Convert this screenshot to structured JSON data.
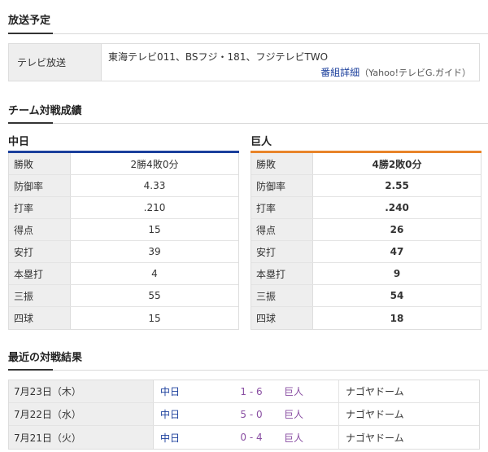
{
  "broadcast": {
    "title": "放送予定",
    "label": "テレビ放送",
    "channels": "東海テレビ011、BSフジ・181、フジテレビTWO",
    "detail_link": "番組詳細",
    "detail_source": "（Yahoo!テレビG.ガイド）"
  },
  "matchup": {
    "title": "チーム対戦成績",
    "teams": [
      {
        "name": "中日",
        "color": "#1b3f9c",
        "rows": [
          {
            "label": "勝敗",
            "value": "2勝4敗0分"
          },
          {
            "label": "防御率",
            "value": "4.33"
          },
          {
            "label": "打率",
            "value": ".210"
          },
          {
            "label": "得点",
            "value": "15"
          },
          {
            "label": "安打",
            "value": "39"
          },
          {
            "label": "本塁打",
            "value": "4"
          },
          {
            "label": "三振",
            "value": "55"
          },
          {
            "label": "四球",
            "value": "15"
          }
        ]
      },
      {
        "name": "巨人",
        "color": "#e8842a",
        "rows": [
          {
            "label": "勝敗",
            "value": "4勝2敗0分"
          },
          {
            "label": "防御率",
            "value": "2.55"
          },
          {
            "label": "打率",
            "value": ".240"
          },
          {
            "label": "得点",
            "value": "26"
          },
          {
            "label": "安打",
            "value": "47"
          },
          {
            "label": "本塁打",
            "value": "9"
          },
          {
            "label": "三振",
            "value": "54"
          },
          {
            "label": "四球",
            "value": "18"
          }
        ]
      }
    ]
  },
  "recent": {
    "title": "最近の対戦結果",
    "results": [
      {
        "date": "7月23日（木）",
        "home": "中日",
        "score": "1 - 6",
        "away": "巨人",
        "venue": "ナゴヤドーム"
      },
      {
        "date": "7月22日（水）",
        "home": "中日",
        "score": "5 - 0",
        "away": "巨人",
        "venue": "ナゴヤドーム"
      },
      {
        "date": "7月21日（火）",
        "home": "中日",
        "score": "0 - 4",
        "away": "巨人",
        "venue": "ナゴヤドーム"
      }
    ]
  }
}
